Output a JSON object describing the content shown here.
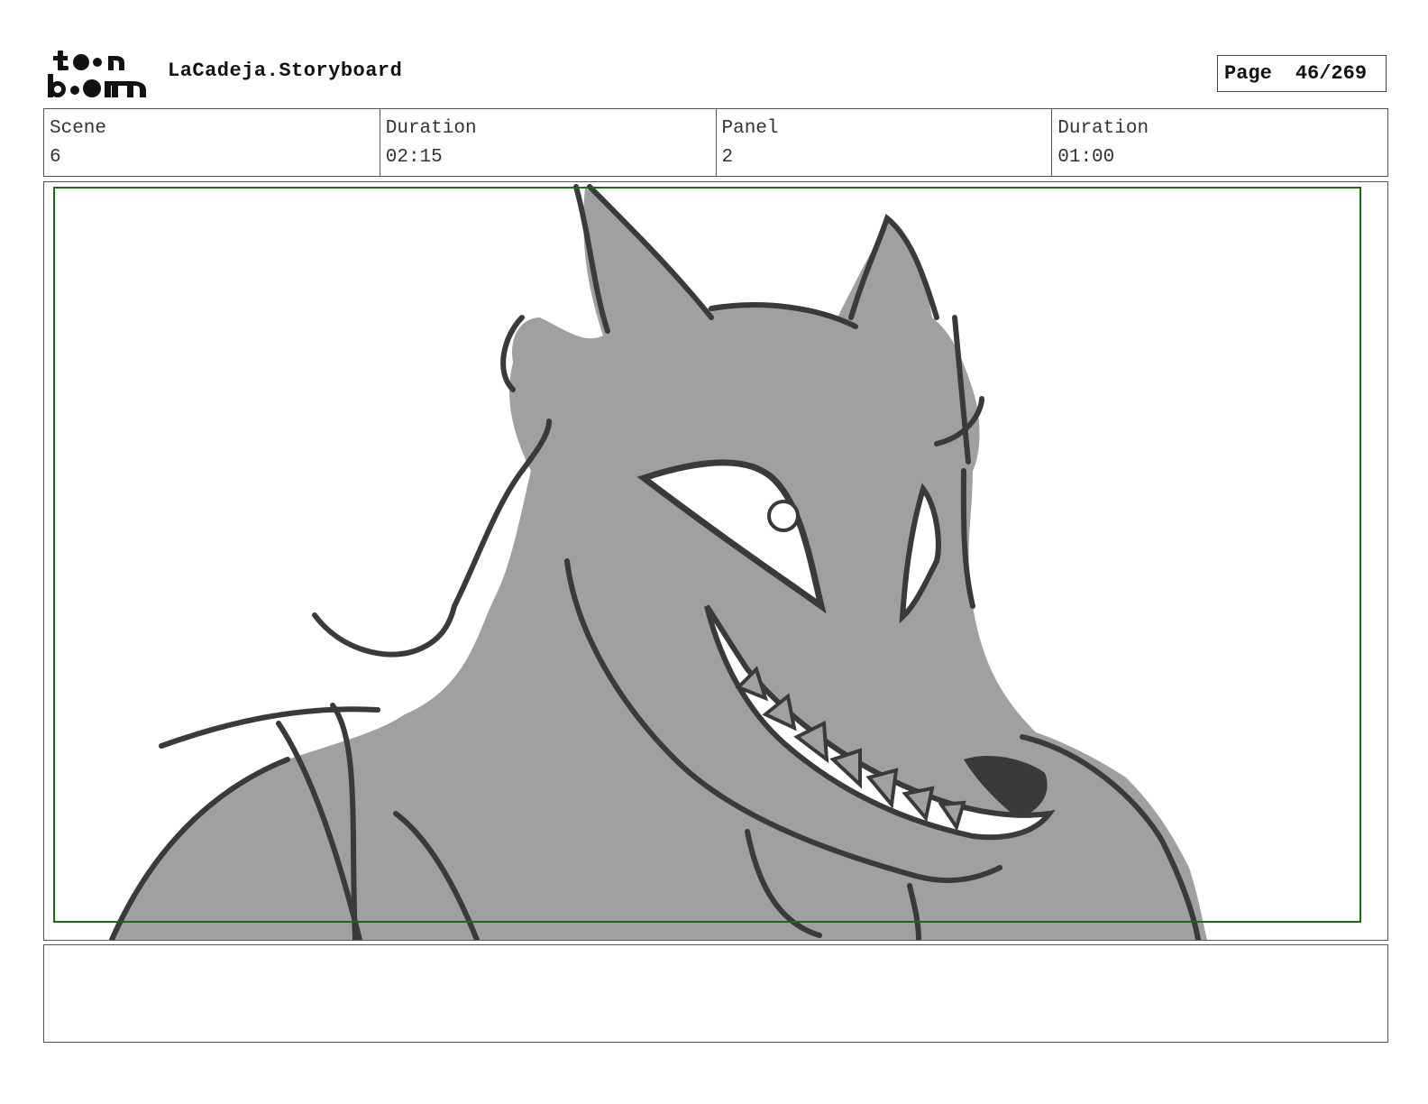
{
  "header": {
    "logo_icon": "toonboom-logo",
    "project_title": "LaCadeja.Storyboard",
    "page_label": "Page",
    "page_number": "46/269"
  },
  "info": {
    "scene_label": "Scene",
    "scene_value": "6",
    "scene_duration_label": "Duration",
    "scene_duration_value": "02:15",
    "panel_label": "Panel",
    "panel_value": "2",
    "panel_duration_label": "Duration",
    "panel_duration_value": "01:00"
  },
  "panel": {
    "image_icon": "wolf-sketch",
    "safe_frame_color": "#1a6b1a",
    "fill_color": "#a0a0a0",
    "line_color": "#3a3a3a"
  },
  "notes": {
    "text": ""
  }
}
